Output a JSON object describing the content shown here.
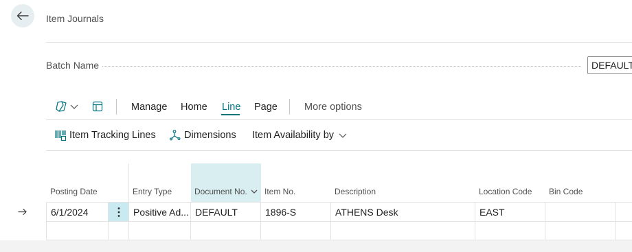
{
  "header": {
    "title": "Item Journals"
  },
  "batch": {
    "label": "Batch Name",
    "value": "DEFAULT"
  },
  "toolbar": {
    "items": [
      "Manage",
      "Home",
      "Line",
      "Page"
    ],
    "active": "Line",
    "more": "More options"
  },
  "subbar": {
    "item_tracking": "Item Tracking Lines",
    "dimensions": "Dimensions",
    "availability": "Item Availability by"
  },
  "grid": {
    "columns": [
      "Posting Date",
      "Entry Type",
      "Document No.",
      "Item No.",
      "Description",
      "Location Code",
      "Bin Code"
    ],
    "sorted_column": "Document No.",
    "rows": [
      {
        "posting_date": "6/1/2024",
        "entry_type": "Positive Ad...",
        "document_no": "DEFAULT",
        "item_no": "1896-S",
        "description": "ATHENS Desk",
        "location_code": "EAST",
        "bin_code": ""
      }
    ]
  },
  "colors": {
    "accent": "#00737e",
    "column_highlight": "#d9eef1"
  }
}
